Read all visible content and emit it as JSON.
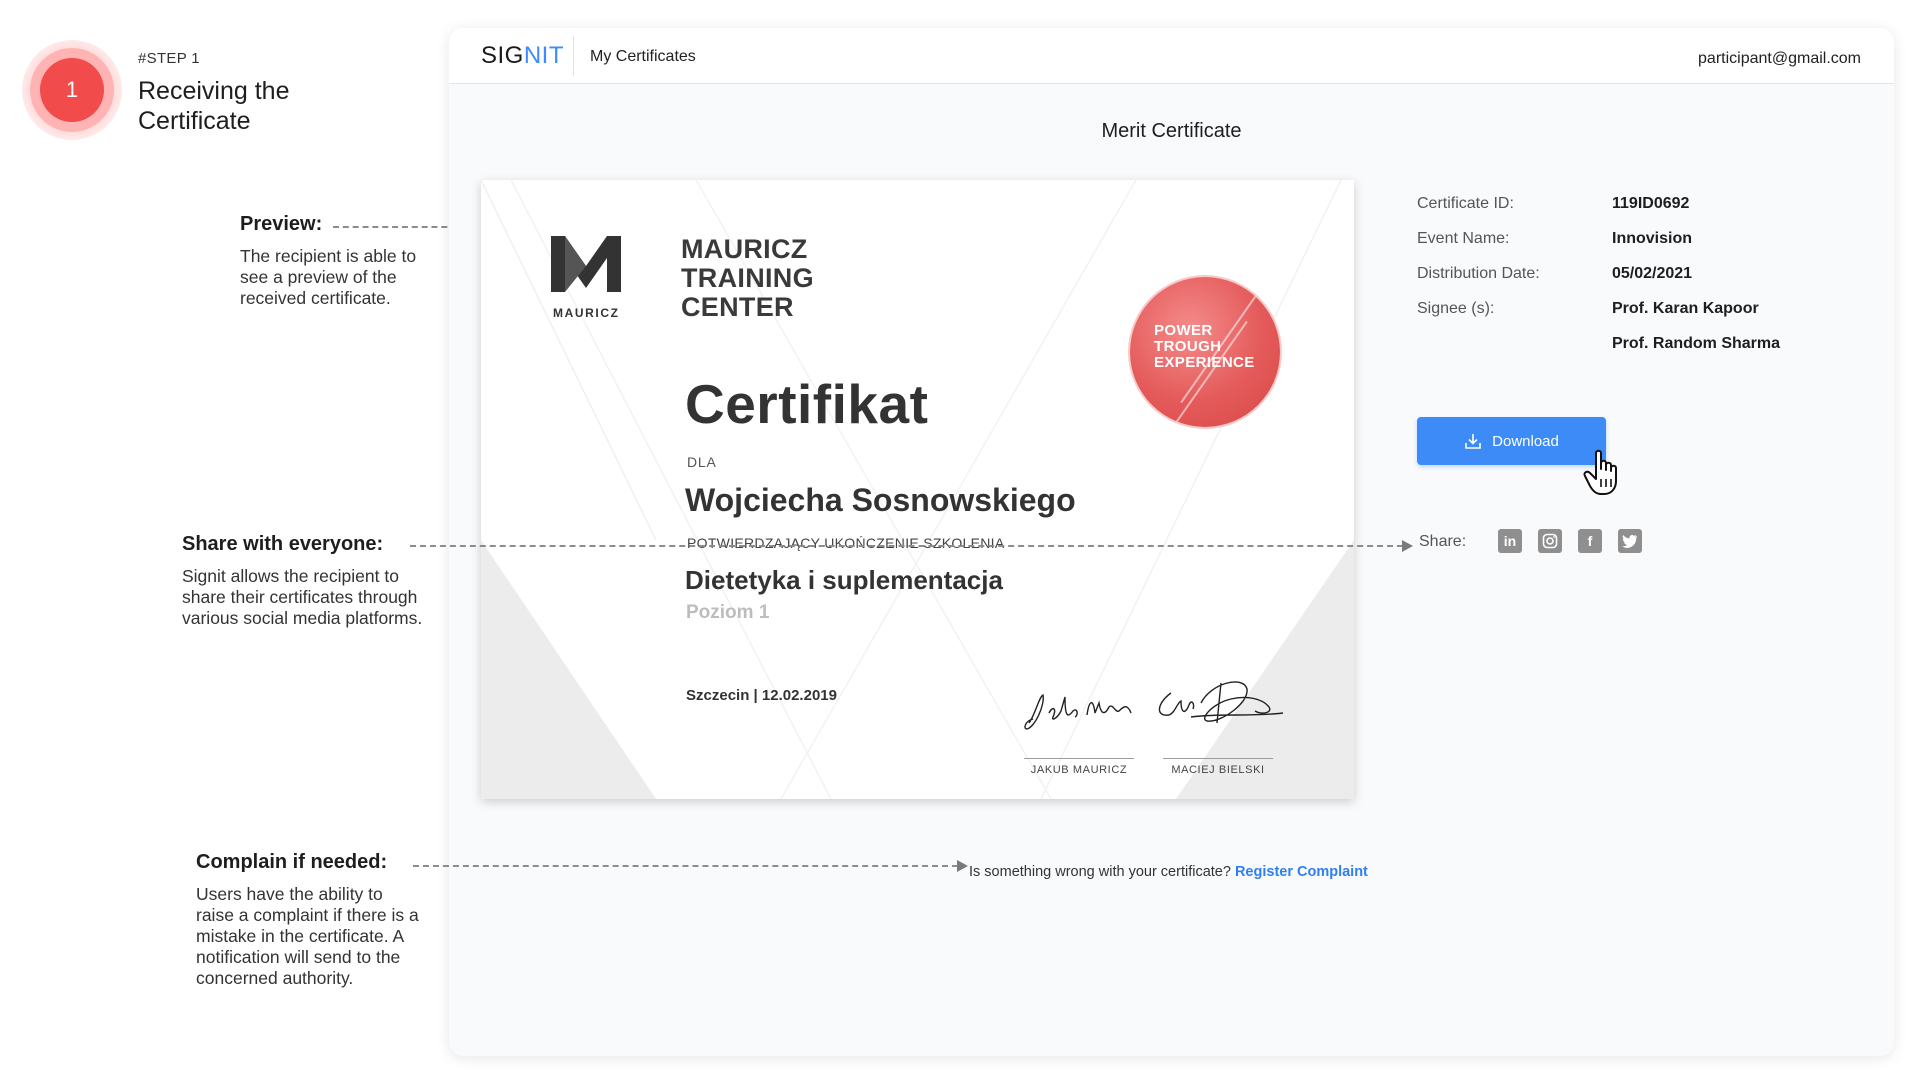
{
  "step": {
    "number": "1",
    "tag": "#STEP 1",
    "title": "Receiving the Certificate"
  },
  "annotations": {
    "preview": {
      "title": "Preview:",
      "text": "The recipient is able to see a preview of the received certificate."
    },
    "share": {
      "title": "Share with everyone:",
      "text": "Signit allows the recipient to share their certificates through various social media platforms."
    },
    "complain": {
      "title": "Complain if needed:",
      "text": "Users have the ability to raise a complaint if there is a mistake in the certificate. A notification will send to the concerned authority."
    }
  },
  "app": {
    "logo_main": "SIG",
    "logo_accent": "NIT",
    "nav_link": "My Certificates",
    "user_email": "participant@gmail.com",
    "page_title": "Merit Certificate"
  },
  "certificate": {
    "logo_caption": "MAURICZ",
    "brand_name": "MAURICZ TRAINING CENTER",
    "seal_text": "POWER TROUGH EXPERIENCE",
    "heading": "Certifikat",
    "for_label": "DLA",
    "recipient": "Wojciecha Sosnowskiego",
    "confirmation": "POTWIERDZAJĄCY UKOŃCZENIE SZKOLENIA",
    "course": "Dietetyka i suplementacja",
    "level": "Poziom 1",
    "place_date": "Szczecin | 12.02.2019",
    "signer_1": "JAKUB MAURICZ",
    "signer_2": "MACIEJ BIELSKI"
  },
  "details": {
    "certificate_id_label": "Certificate ID:",
    "certificate_id": "119ID0692",
    "event_name_label": "Event Name:",
    "event_name": "Innovision",
    "distribution_date_label": "Distribution Date:",
    "distribution_date": "05/02/2021",
    "signees_label": "Signee (s):",
    "signee_1": "Prof. Karan Kapoor",
    "signee_2": "Prof. Random Sharma"
  },
  "actions": {
    "download_label": "Download",
    "share_label": "Share:",
    "social_icons": [
      "linkedin-icon",
      "instagram-icon",
      "facebook-icon",
      "twitter-icon"
    ],
    "complaint_prompt": "Is something wrong with your certificate?",
    "complaint_link": "Register Complaint"
  },
  "colors": {
    "accent_blue": "#3d8bf7",
    "step_red": "#f14b4b",
    "seal_red": "#e45a5a"
  }
}
